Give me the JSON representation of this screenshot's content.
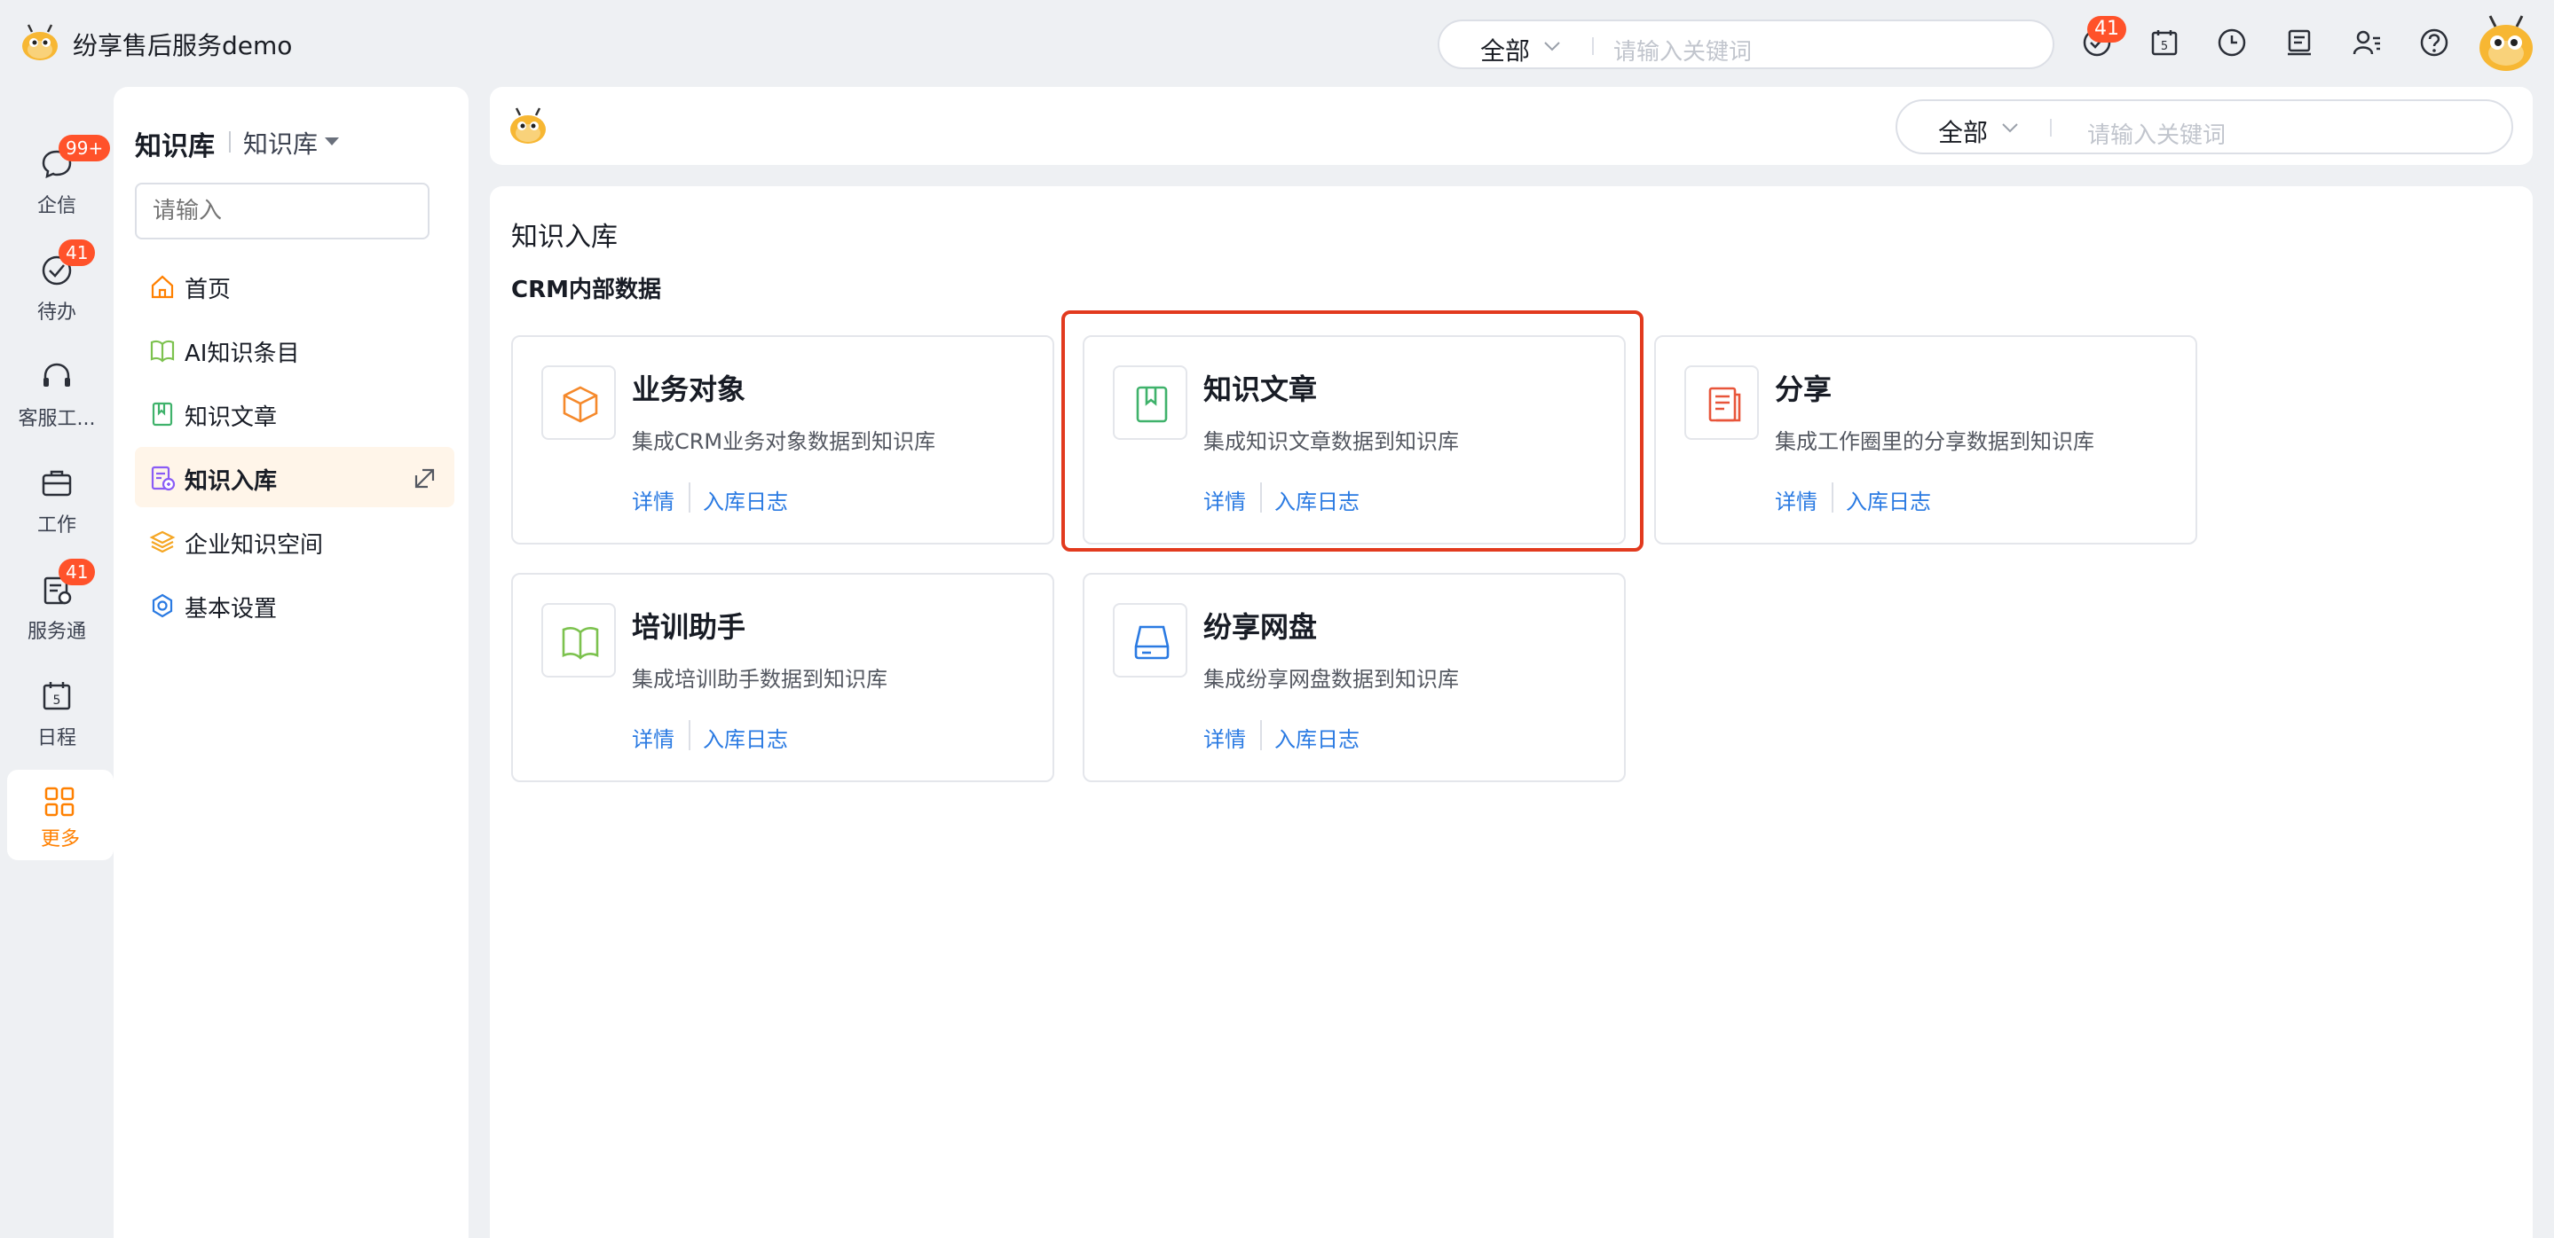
{
  "app": {
    "title": "纷享售后服务demo"
  },
  "top_search": {
    "scope": "全部",
    "placeholder": "请输入关键词"
  },
  "top_badge": "41",
  "rail": {
    "items": [
      {
        "label": "企信",
        "badge": "99+"
      },
      {
        "label": "待办",
        "badge": "41"
      },
      {
        "label": "客服工..."
      },
      {
        "label": "工作"
      },
      {
        "label": "服务通",
        "badge": "41"
      },
      {
        "label": "日程",
        "calendar_day": "5"
      },
      {
        "label": "更多"
      }
    ]
  },
  "sidenav": {
    "title": "知识库",
    "subtitle": "知识库",
    "search_placeholder": "请输入",
    "items": [
      {
        "label": "首页"
      },
      {
        "label": "AI知识条目"
      },
      {
        "label": "知识文章"
      },
      {
        "label": "知识入库"
      },
      {
        "label": "企业知识空间"
      },
      {
        "label": "基本设置"
      }
    ]
  },
  "main_search": {
    "scope": "全部",
    "placeholder": "请输入关键词"
  },
  "page": {
    "title": "知识入库",
    "section": "CRM内部数据",
    "cards": [
      {
        "title": "业务对象",
        "desc": "集成CRM业务对象数据到知识库",
        "link1": "详情",
        "link2": "入库日志"
      },
      {
        "title": "知识文章",
        "desc": "集成知识文章数据到知识库",
        "link1": "详情",
        "link2": "入库日志"
      },
      {
        "title": "分享",
        "desc": "集成工作圈里的分享数据到知识库",
        "link1": "详情",
        "link2": "入库日志"
      },
      {
        "title": "培训助手",
        "desc": "集成培训助手数据到知识库",
        "link1": "详情",
        "link2": "入库日志"
      },
      {
        "title": "纷享网盘",
        "desc": "集成纷享网盘数据到知识库",
        "link1": "详情",
        "link2": "入库日志"
      }
    ]
  },
  "colors": {
    "accent": "#ff8000",
    "link": "#2a7ae2",
    "badge": "#ff522a",
    "highlight": "#e23a1e",
    "active_bg": "#fff5e9"
  }
}
